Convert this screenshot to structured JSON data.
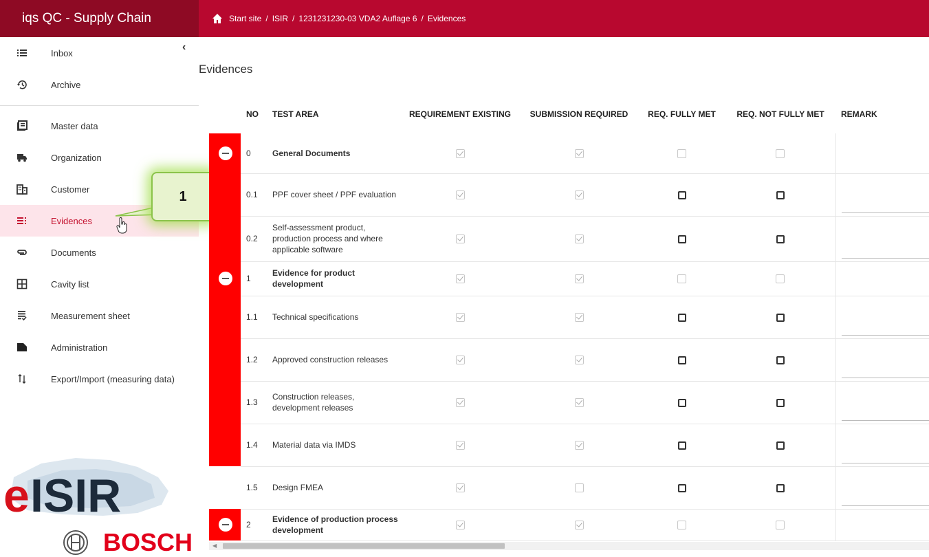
{
  "app": {
    "title": "iqs QC - Supply Chain"
  },
  "breadcrumb": [
    "Start site",
    "ISIR",
    "1231231230-03 VDA2 Auflage 6",
    "Evidences"
  ],
  "sidebar": {
    "items": [
      {
        "label": "Inbox",
        "icon": "list-icon"
      },
      {
        "label": "Archive",
        "icon": "history-icon"
      },
      {
        "label": "Master data",
        "icon": "book-icon"
      },
      {
        "label": "Organization",
        "icon": "truck-icon"
      },
      {
        "label": "Customer",
        "icon": "building-icon"
      },
      {
        "label": "Evidences",
        "icon": "checklist-icon",
        "active": true
      },
      {
        "label": "Documents",
        "icon": "paperclip-icon"
      },
      {
        "label": "Cavity list",
        "icon": "grid-icon"
      },
      {
        "label": "Measurement sheet",
        "icon": "sheet-icon"
      },
      {
        "label": "Administration",
        "icon": "file-icon"
      },
      {
        "label": "Export/Import (measuring data)",
        "icon": "import-export-icon"
      }
    ]
  },
  "logos": {
    "eisir": "eISIR",
    "bosch": "BOSCH"
  },
  "callout": {
    "label": "1"
  },
  "main": {
    "title": "Evidences",
    "columns": [
      "NO",
      "TEST AREA",
      "REQUIREMENT EXISTING",
      "SUBMISSION REQUIRED",
      "REQ. FULLY MET",
      "REQ. NOT FULLY MET",
      "REMARK"
    ],
    "rows": [
      {
        "no": "0",
        "area": "General Documents",
        "group": true,
        "red": true,
        "req": true,
        "sub": true,
        "enabled": false
      },
      {
        "no": "0.1",
        "area": "PPF cover sheet / PPF evaluation",
        "group": false,
        "red": true,
        "req": true,
        "sub": true,
        "enabled": true
      },
      {
        "no": "0.2",
        "area": "Self-assessment product, production process and where applicable software",
        "group": false,
        "red": true,
        "req": true,
        "sub": true,
        "enabled": true
      },
      {
        "no": "1",
        "area": "Evidence for product development",
        "group": true,
        "red": true,
        "req": true,
        "sub": true,
        "enabled": false
      },
      {
        "no": "1.1",
        "area": "Technical specifications",
        "group": false,
        "red": true,
        "req": true,
        "sub": true,
        "enabled": true
      },
      {
        "no": "1.2",
        "area": "Approved construction releases",
        "group": false,
        "red": true,
        "req": true,
        "sub": true,
        "enabled": true
      },
      {
        "no": "1.3",
        "area": "Construction releases, development releases",
        "group": false,
        "red": true,
        "req": true,
        "sub": true,
        "enabled": true
      },
      {
        "no": "1.4",
        "area": "Material data via IMDS",
        "group": false,
        "red": true,
        "req": true,
        "sub": true,
        "enabled": true
      },
      {
        "no": "1.5",
        "area": "Design FMEA",
        "group": false,
        "red": false,
        "req": true,
        "sub": false,
        "enabled": true
      },
      {
        "no": "2",
        "area": "Evidence of production process development",
        "group": true,
        "red": true,
        "req": true,
        "sub": true,
        "enabled": false
      }
    ]
  },
  "colors": {
    "header_dark": "#8e0a24",
    "header": "#b8082f",
    "strip_red": "#ff0000",
    "active_bg": "#fde4ea",
    "active_text": "#c4122f"
  }
}
